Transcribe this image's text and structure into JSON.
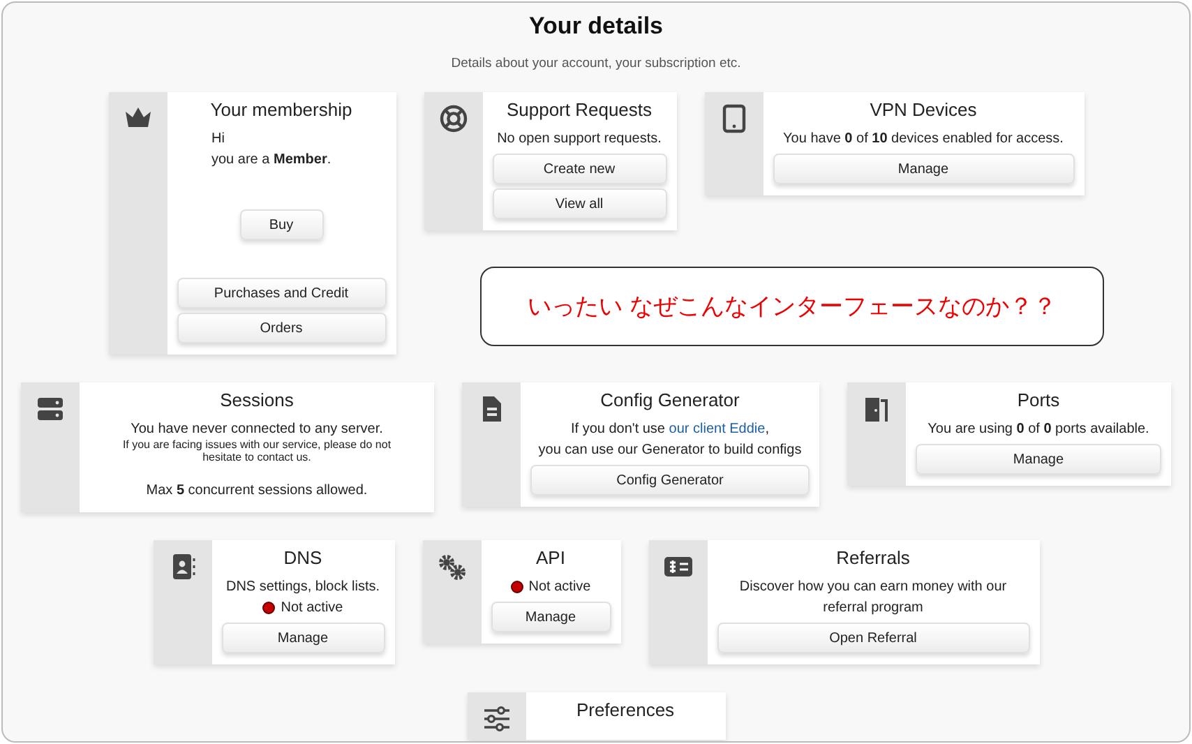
{
  "title": "Your details",
  "subtitle": "Details about your account, your subscription etc.",
  "rows": [
    [
      {
        "title": "Your membership",
        "items": [
          {
            "kind": "greeting",
            "text": "Hi"
          },
          {
            "kind": "greeting",
            "text": "you are a **Member**."
          },
          {
            "kind": "small-button",
            "text": "Buy"
          },
          {
            "kind": "button",
            "text": "Purchases and Credit"
          },
          {
            "kind": "button",
            "text": "Orders"
          }
        ]
      },
      {
        "title": "Support Requests",
        "items": [
          {
            "kind": "text",
            "text": "No open support requests."
          },
          {
            "kind": "button",
            "text": "Create new"
          },
          {
            "kind": "button",
            "text": "View all"
          }
        ]
      },
      {
        "title": "VPN Devices",
        "items": [
          {
            "kind": "text",
            "text": "You have **0** of **10** devices enabled for access."
          },
          {
            "kind": "button",
            "text": "Manage"
          }
        ]
      }
    ],
    [
      {
        "title": "Sessions",
        "items": [
          {
            "kind": "text",
            "text": "You have never connected to any server."
          },
          {
            "kind": "note",
            "text": "If you are facing issues with our service, please do not hesitate to contact us."
          },
          {
            "kind": "footer",
            "text": "Max **5** concurrent sessions allowed."
          }
        ]
      },
      {
        "title": "Config Generator",
        "items": [
          {
            "kind": "link-text",
            "before": "If you don't use ",
            "link": "our client Eddie",
            "after": ","
          },
          {
            "kind": "text",
            "text": "you can use our Generator to build configs"
          },
          {
            "kind": "button",
            "text": "Config Generator"
          }
        ]
      },
      {
        "title": "Ports",
        "items": [
          {
            "kind": "text",
            "text": "You are using **0** of **0** ports available."
          },
          {
            "kind": "button",
            "text": "Manage"
          }
        ]
      }
    ],
    [
      {
        "title": "DNS",
        "items": [
          {
            "kind": "text",
            "text": "DNS settings, block lists."
          },
          {
            "kind": "status",
            "text": "Not active",
            "active": false
          },
          {
            "kind": "button",
            "text": "Manage"
          }
        ]
      },
      {
        "title": "API",
        "items": [
          {
            "kind": "status",
            "text": "Not active",
            "active": false
          },
          {
            "kind": "button",
            "text": "Manage"
          }
        ]
      },
      {
        "title": "Referrals",
        "items": [
          {
            "kind": "text",
            "text": "Discover how you can earn money with our referral program"
          },
          {
            "kind": "button",
            "text": "Open Referral"
          }
        ]
      }
    ],
    [
      {
        "title": "Preferences"
      }
    ]
  ],
  "callout": {
    "text": "いったい なぜこんなインターフェースなのか？？"
  }
}
